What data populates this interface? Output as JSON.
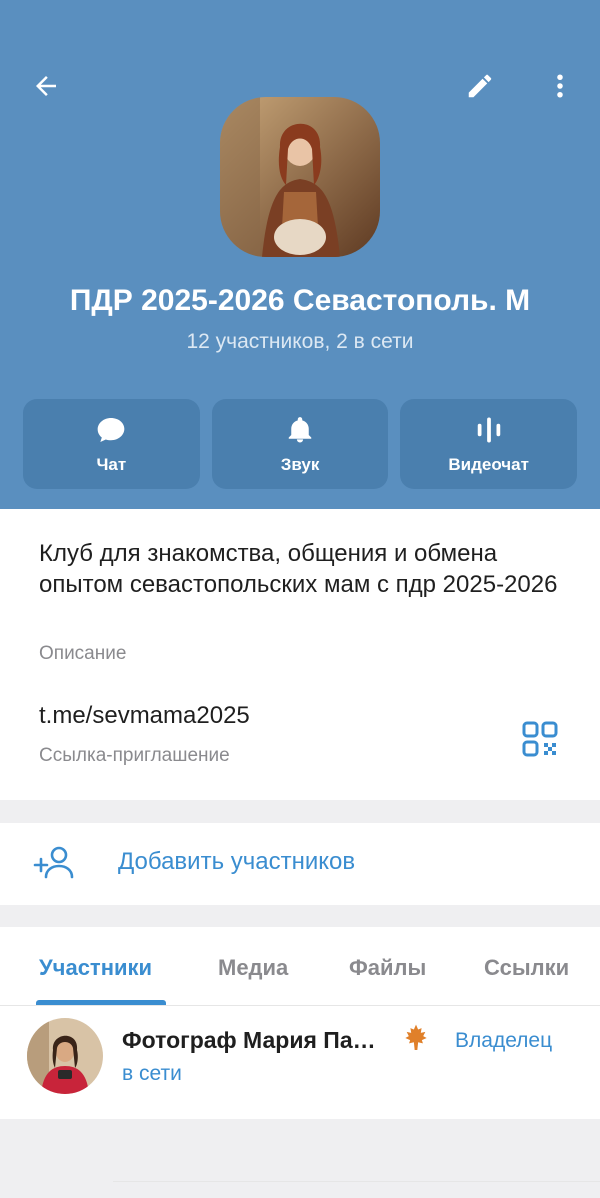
{
  "header": {
    "back_icon": "arrow-left-icon",
    "edit_icon": "pencil-icon",
    "more_icon": "more-vertical-icon",
    "title": "ПДР 2025-2026 Севастополь. М",
    "subtitle": "12 участников, 2 в сети",
    "colors": {
      "header_bg": "#5a8fbf",
      "action_bg": "#4a7fae",
      "accent": "#3a8dd0"
    }
  },
  "actions": [
    {
      "label": "Чат",
      "icon": "chat-bubble-icon"
    },
    {
      "label": "Звук",
      "icon": "bell-icon"
    },
    {
      "label": "Видеочат",
      "icon": "voice-wave-icon"
    }
  ],
  "info": {
    "description": "Клуб для знакомства, общения и обмена опытом севастопольских мам с пдр 2025-2026",
    "description_label": "Описание",
    "link": "t.me/sevmama2025",
    "link_label": "Ссылка-приглашение",
    "qr_icon": "qr-code-icon"
  },
  "add_members": {
    "label": "Добавить участников",
    "icon": "add-user-icon"
  },
  "tabs": [
    {
      "label": "Участники",
      "active": true
    },
    {
      "label": "Медиа",
      "active": false
    },
    {
      "label": "Файлы",
      "active": false
    },
    {
      "label": "Ссылки",
      "active": false
    }
  ],
  "members": [
    {
      "name": "Фотограф Мария Па…",
      "status": "в сети",
      "role": "Владелец",
      "emoji_icon": "maple-leaf-icon"
    }
  ]
}
